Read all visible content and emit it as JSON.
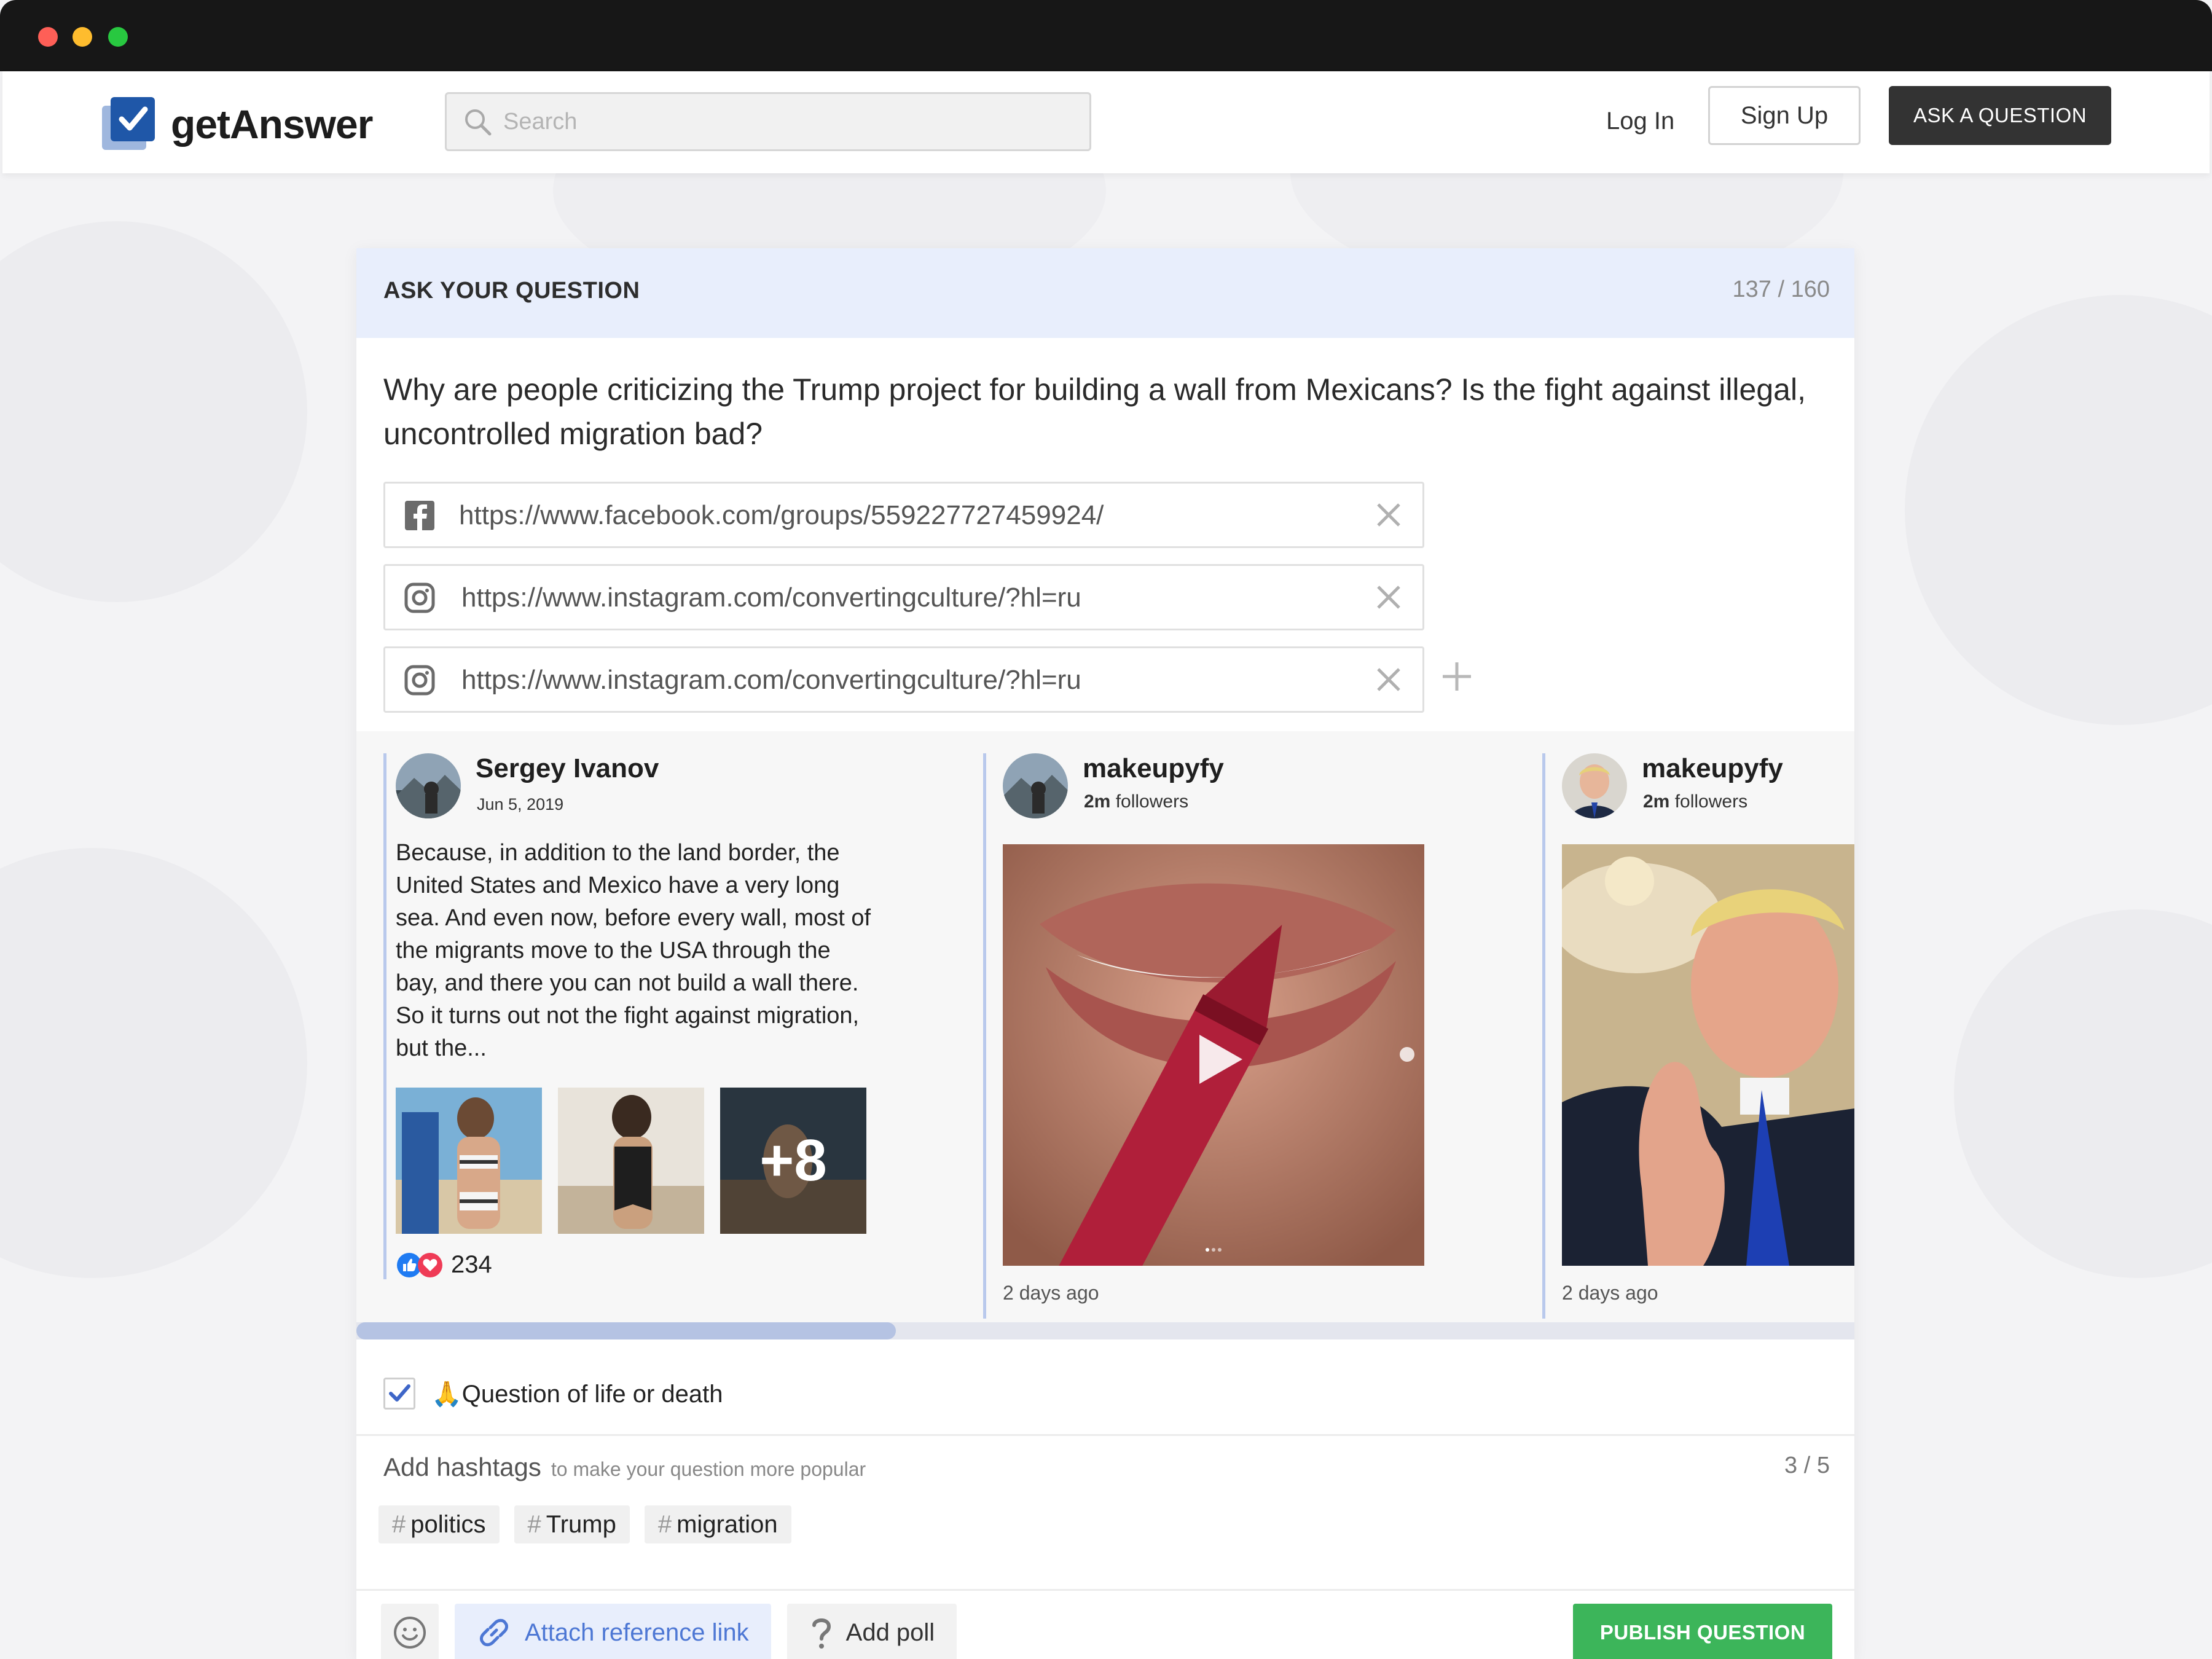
{
  "header": {
    "logo_text": "getAnswer",
    "search_placeholder": "Search",
    "login_label": "Log In",
    "signup_label": "Sign Up",
    "ask_label": "ASK A QUESTION"
  },
  "form": {
    "title": "ASK YOUR QUESTION",
    "char_counter": "137 / 160",
    "question": "Why are people criticizing the Trump project for building a wall from Mexicans? Is the fight against illegal, uncontrolled migration bad?",
    "links": [
      {
        "icon": "facebook-icon",
        "url": "https://www.facebook.com/groups/559227727459924/"
      },
      {
        "icon": "instagram-icon",
        "url": "https://www.instagram.com/convertingculture/?hl=ru"
      },
      {
        "icon": "instagram-icon",
        "url": "https://www.instagram.com/convertingculture/?hl=ru"
      }
    ]
  },
  "previews": [
    {
      "author": "Sergey Ivanov",
      "date": "Jun 5, 2019",
      "text": "Because, in addition to the land border, the United States and Mexico have a very long sea. And even now, before every wall, most of the migrants move to the USA through the bay, and there you can not build a wall there. So it turns out not the fight against migration, but the...",
      "more_photos": "+8",
      "reaction_count": "234"
    },
    {
      "author": "makeupyfy",
      "followers": "2m",
      "followers_label": "followers",
      "time_ago": "2 days ago"
    },
    {
      "author": "makeupyfy",
      "followers": "2m",
      "followers_label": "followers",
      "time_ago": "2 days ago"
    }
  ],
  "scroll_position": 0.36,
  "important": {
    "checked": true,
    "label": "🙏Question of life or death"
  },
  "hashtags": {
    "label": "Add hashtags",
    "hint": "to make your question more popular",
    "count": "3 / 5",
    "tags": [
      "politics",
      "Trump",
      "migration"
    ]
  },
  "toolbar": {
    "attach_label": "Attach reference link",
    "poll_label": "Add poll",
    "publish_label": "PUBLISH QUESTION"
  },
  "colors": {
    "accent_blue": "#4d77d4",
    "publish_green": "#3cb55a",
    "header_tint": "#e8eefc",
    "dark_button": "#333333"
  }
}
